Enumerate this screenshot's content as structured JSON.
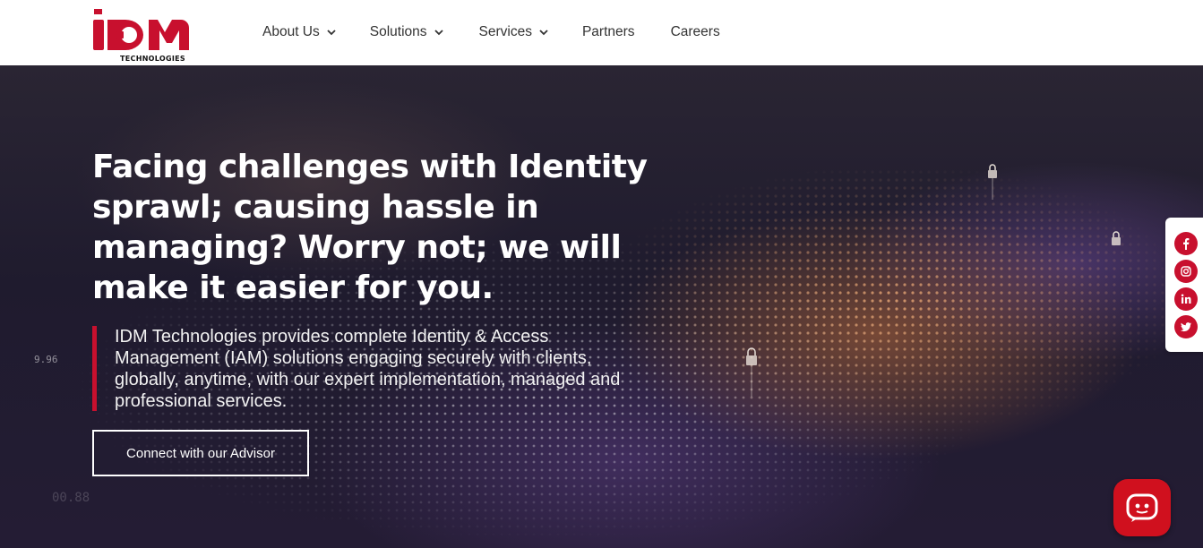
{
  "brand": {
    "logo_text": "iDM",
    "logo_sub": "TECHNOLOGIES",
    "accent": "#c8102e"
  },
  "nav": {
    "items": [
      {
        "label": "About Us",
        "has_dropdown": true
      },
      {
        "label": "Solutions",
        "has_dropdown": true
      },
      {
        "label": "Services",
        "has_dropdown": true
      },
      {
        "label": "Partners",
        "has_dropdown": false
      },
      {
        "label": "Careers",
        "has_dropdown": false
      }
    ]
  },
  "hero": {
    "headline": "Facing challenges with Identity sprawl; causing hassle in managing? Worry not; we will make it easier for you.",
    "description": "IDM Technologies provides complete Identity & Access Management (IAM) solutions engaging securely with clients, globally, anytime, with our expert implementation, managed and professional services.",
    "cta_label": "Connect with our Advisor",
    "bg_text_left": "9.96",
    "bg_text_bottom": "00.88"
  },
  "social": {
    "items": [
      "facebook-icon",
      "instagram-icon",
      "linkedin-icon",
      "twitter-icon"
    ]
  },
  "chat": {
    "icon": "chat-bot-icon"
  }
}
